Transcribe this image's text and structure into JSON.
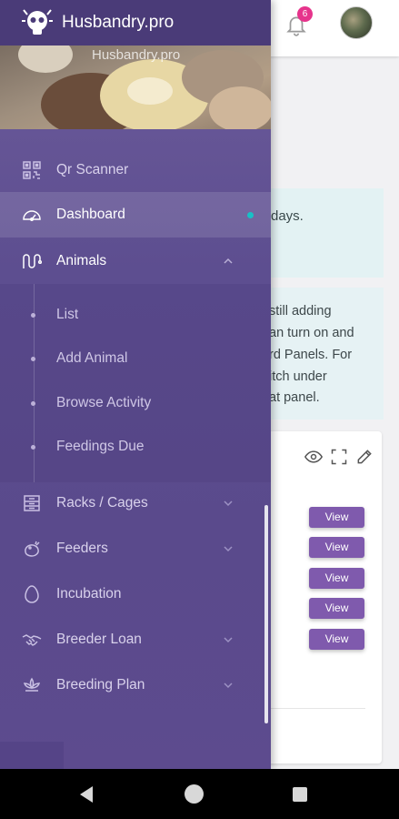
{
  "app": {
    "brand": "Husbandry.pro",
    "username_partial": "Husbandry.pro",
    "notification_count": "6",
    "accent_color": "#7f5aad",
    "drawer_color": "#5d4e90",
    "active_indicator_color": "#18c0c6"
  },
  "nav": {
    "items": [
      {
        "label": "Qr Scanner",
        "icon": "qr-code-icon"
      },
      {
        "label": "Dashboard",
        "icon": "dashboard-gauge-icon",
        "active": true
      },
      {
        "label": "Animals",
        "icon": "snake-icon",
        "expanded": true
      },
      {
        "label": "Racks / Cages",
        "icon": "rack-icon"
      },
      {
        "label": "Feeders",
        "icon": "feeder-icon"
      },
      {
        "label": "Incubation",
        "icon": "egg-icon"
      },
      {
        "label": "Breeder Loan",
        "icon": "handshake-icon"
      },
      {
        "label": "Breeding Plan",
        "icon": "lotus-icon"
      }
    ],
    "animals_sub": [
      {
        "label": "List"
      },
      {
        "label": "Add Animal"
      },
      {
        "label": "Browse Activity"
      },
      {
        "label": "Feedings Due"
      }
    ]
  },
  "main": {
    "panel1_text": "days.",
    "panel2_lines": [
      "still adding",
      "an turn on and",
      "rd Panels. For",
      "itch under",
      "at panel."
    ],
    "view_buttons": [
      "View",
      "View",
      "View",
      "View",
      "View"
    ]
  }
}
